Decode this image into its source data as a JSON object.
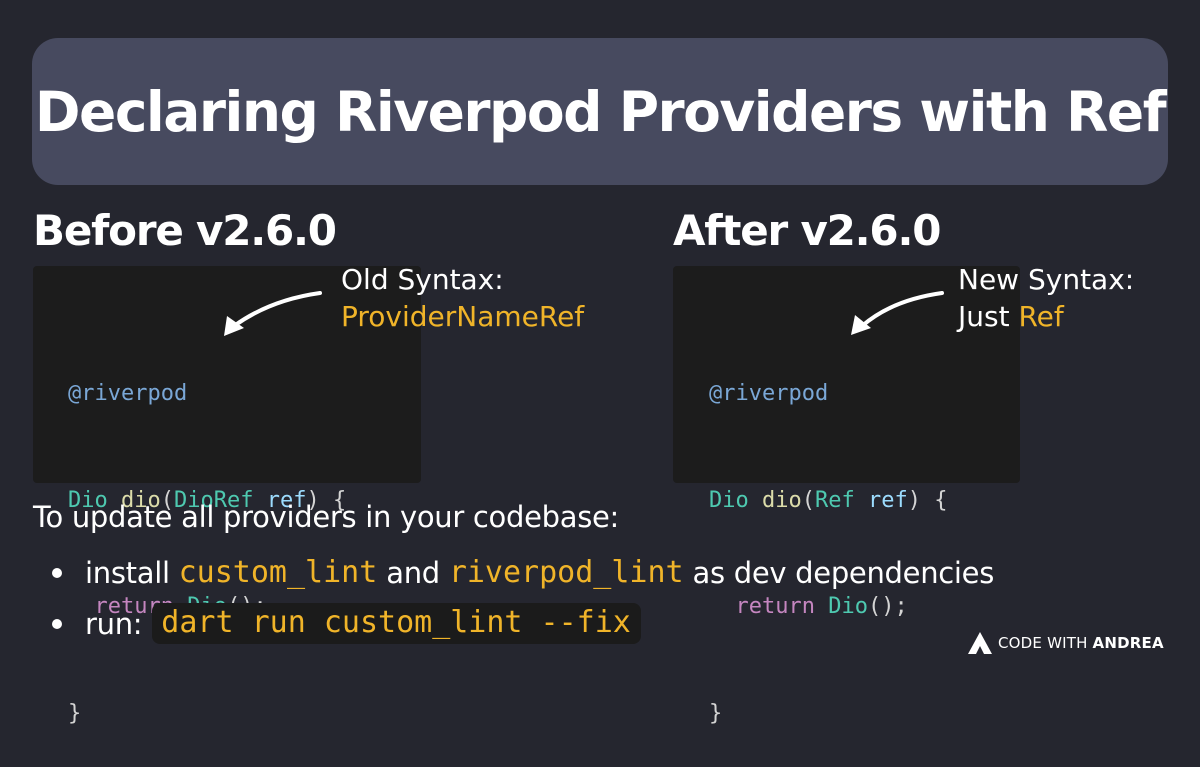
{
  "title": "Declaring Riverpod Providers with Ref",
  "before": {
    "heading": "Before v2.6.0",
    "code": {
      "l1": "@riverpod",
      "l2_type": "Dio",
      "l2_fn": "dio",
      "l2_open": "(",
      "l2_param_type": "DioRef",
      "l2_param": "ref",
      "l2_close": ") {",
      "l3_kw": "return",
      "l3_type": "Dio",
      "l3_end": "();",
      "l4": "}"
    },
    "callout_line1": "Old Syntax:",
    "callout_line2": "ProviderNameRef"
  },
  "after": {
    "heading": "After v2.6.0",
    "code": {
      "l1": "@riverpod",
      "l2_type": "Dio",
      "l2_fn": "dio",
      "l2_open": "(",
      "l2_param_type": "Ref",
      "l2_param": "ref",
      "l2_close": ") {",
      "l3_kw": "return",
      "l3_type": "Dio",
      "l3_end": "();",
      "l4": "}"
    },
    "callout_line1": "New Syntax:",
    "callout_line2_prefix": "Just ",
    "callout_line2_highlight": "Ref"
  },
  "instructions": {
    "intro": "To update all providers in your codebase:",
    "bullet1": {
      "prefix": "install ",
      "pkg1": "custom_lint",
      "middle": " and ",
      "pkg2": "riverpod_lint",
      "suffix": " as dev dependencies"
    },
    "bullet2": {
      "prefix": "run:",
      "command": "dart run custom_lint --fix"
    }
  },
  "brand": {
    "word1": "CODE",
    "word2": "WITH",
    "word3": "ANDREA"
  },
  "colors": {
    "background": "#25262f",
    "banner": "#474a5f",
    "code_bg": "#1c1c1c",
    "accent_yellow": "#f0b429",
    "annotation": "#7aa7d6",
    "type": "#4ec9b0",
    "function": "#dcdcaa",
    "parameter": "#9cdcfe",
    "keyword": "#c586c0"
  },
  "icons": {
    "arrow": "curved-arrow",
    "logo": "andrea-a-logo"
  }
}
